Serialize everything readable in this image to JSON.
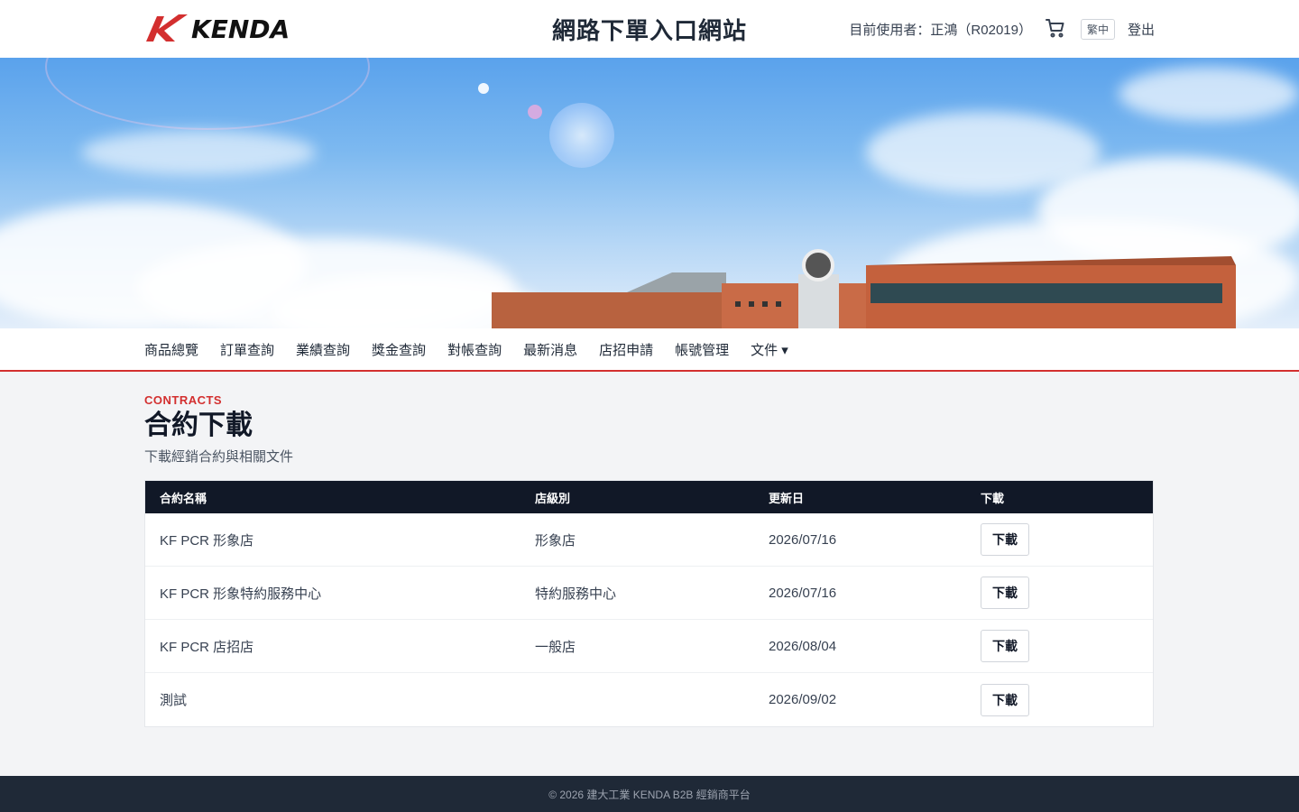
{
  "header": {
    "logo_text": "KENDA",
    "site_title": "網路下單入口網站",
    "user_label": "目前使用者：正鴻（R02019）",
    "lang_label": "繁中",
    "logout_label": "登出"
  },
  "nav": {
    "items": [
      "商品總覽",
      "訂單查詢",
      "業績查詢",
      "獎金查詢",
      "對帳查詢",
      "最新消息",
      "店招申請",
      "帳號管理",
      "文件 ▾"
    ]
  },
  "page": {
    "eyebrow": "CONTRACTS",
    "title": "合約下載",
    "subtitle": "下載經銷合約與相關文件"
  },
  "table": {
    "headers": [
      "合約名稱",
      "店級別",
      "更新日",
      "下載"
    ],
    "rows": [
      {
        "name": "KF PCR 形象店",
        "level": "形象店",
        "date": "2026/07/16",
        "action": "下載"
      },
      {
        "name": "KF PCR 形象特約服務中心",
        "level": "特約服務中心",
        "date": "2026/07/16",
        "action": "下載"
      },
      {
        "name": "KF PCR 店招店",
        "level": "一般店",
        "date": "2026/08/04",
        "action": "下載"
      },
      {
        "name": "測試",
        "level": "",
        "date": "2026/09/02",
        "action": "下載"
      }
    ]
  },
  "footer": {
    "text": "© 2026 建大工業 KENDA B2B 經銷商平台"
  },
  "colors": {
    "accent": "#d32f2f",
    "table_header": "#111827",
    "footer": "#1f2937"
  },
  "icons": {
    "logo": "kenda-k-logo-icon",
    "cart": "cart-icon"
  }
}
